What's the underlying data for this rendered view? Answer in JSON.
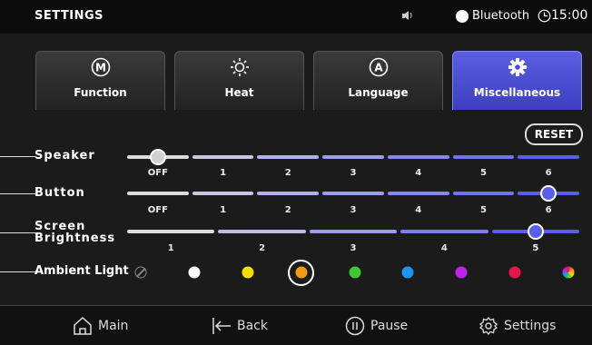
{
  "status_bar": {
    "title": "SETTINGS",
    "bluetooth_label": "Bluetooth",
    "time": "15:00"
  },
  "tabs": [
    {
      "label": "Function",
      "icon": "m-circle-icon",
      "active": false
    },
    {
      "label": "Heat",
      "icon": "sun-icon",
      "active": false
    },
    {
      "label": "Language",
      "icon": "a-circle-icon",
      "active": false
    },
    {
      "label": "Miscellaneous",
      "icon": "gear-icon",
      "active": true
    }
  ],
  "reset_label": "RESET",
  "speaker": {
    "label": "Speaker",
    "ticks": [
      "OFF",
      "1",
      "2",
      "3",
      "4",
      "5",
      "6"
    ],
    "selected_index": 0
  },
  "button": {
    "label": "Button",
    "ticks": [
      "OFF",
      "1",
      "2",
      "3",
      "4",
      "5",
      "6"
    ],
    "selected_index": 6
  },
  "screen_brightness": {
    "label_line1": "Screen",
    "label_line2": "Brightness",
    "ticks": [
      "1",
      "2",
      "3",
      "4",
      "5"
    ],
    "selected_index": 4
  },
  "ambient_light": {
    "label": "Ambient Light",
    "options": [
      "off",
      "#ffffff",
      "#f2e000",
      "#f39a12",
      "#3ec633",
      "#1e94f0",
      "#c020e8",
      "#e8154a",
      "multicolor"
    ],
    "selected_index": 3
  },
  "bottom_nav": {
    "main": "Main",
    "back": "Back",
    "pause": "Pause",
    "settings": "Settings"
  }
}
